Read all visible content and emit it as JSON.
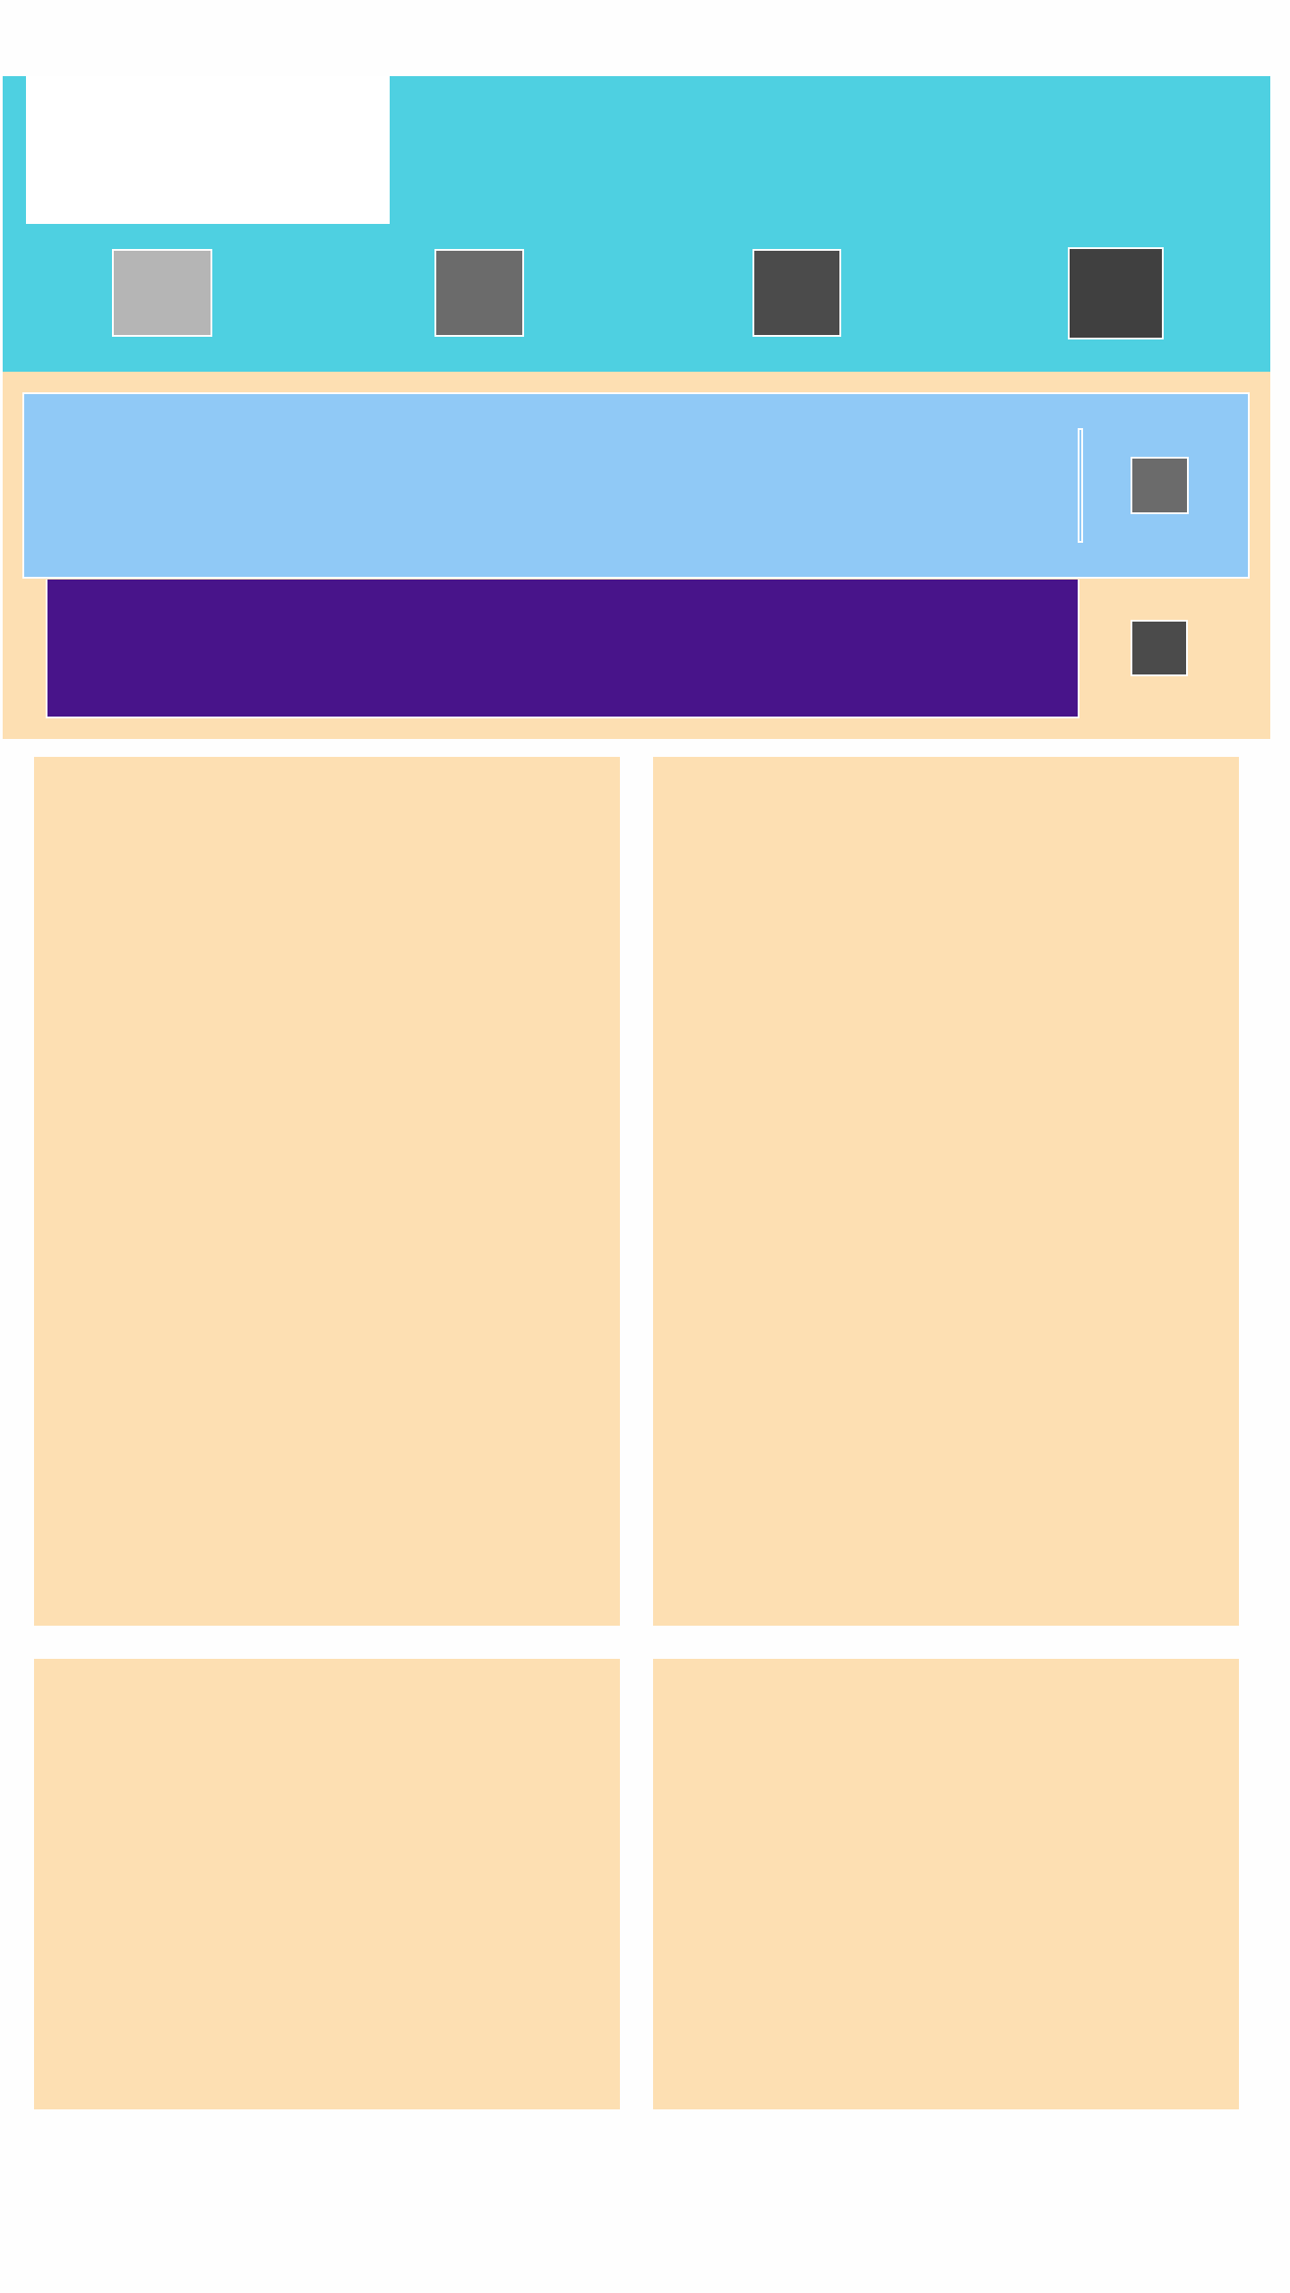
{
  "header": {
    "logo": "",
    "nav": [
      {
        "name": "nav-button-1",
        "color": "#b5b5b5"
      },
      {
        "name": "nav-button-2",
        "color": "#6b6b6b"
      },
      {
        "name": "nav-button-3",
        "color": "#4b4b4b"
      },
      {
        "name": "nav-button-4",
        "color": "#404040"
      }
    ],
    "background": "#4ed0e1"
  },
  "panel": {
    "background": "#fddfb2",
    "search_field": {
      "value": "",
      "background": "#90c9f6"
    },
    "action_bar": {
      "background": "#48148a"
    }
  },
  "cards": [
    {
      "title": ""
    },
    {
      "title": ""
    },
    {
      "title": ""
    },
    {
      "title": ""
    }
  ]
}
